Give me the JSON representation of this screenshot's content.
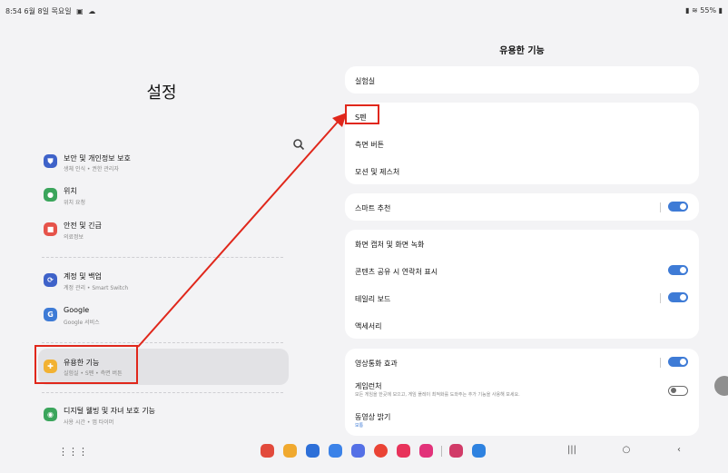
{
  "status_bar": {
    "time_date": "8:54 6월 8일 목요일",
    "battery": "55%"
  },
  "left_panel": {
    "title": "설정",
    "items": [
      {
        "title": "보안 및 개인정보 보호",
        "subtitle": "생체 인식 • 권한 관리자",
        "icon": "shield-icon",
        "color": "#3e62c9"
      },
      {
        "title": "위치",
        "subtitle": "위치 요청",
        "icon": "location-icon",
        "color": "#3ba55c"
      },
      {
        "title": "안전 및 긴급",
        "subtitle": "의료정보",
        "icon": "emergency-icon",
        "color": "#e6534a"
      },
      {
        "title": "계정 및 백업",
        "subtitle": "계정 관리 • Smart Switch",
        "icon": "sync-icon",
        "color": "#3e62c9"
      },
      {
        "title": "Google",
        "subtitle": "Google 서비스",
        "icon": "google-icon",
        "color": "#3e7bd6",
        "icon_text": "G"
      },
      {
        "title": "유용한 기능",
        "subtitle": "실험실 • S펜 • 측면 버튼",
        "icon": "gear-plus-icon",
        "color": "#f2b233"
      },
      {
        "title": "디지털 웰빙 및 자녀 보호 기능",
        "subtitle": "사용 시간 • 앱 타이머",
        "icon": "wellbeing-icon",
        "color": "#3ba55c"
      }
    ]
  },
  "right_panel": {
    "title": "유용한 기능",
    "labs": "실험실",
    "spen": "S펜",
    "side_button": "측면 버튼",
    "motions": "모션 및 제스처",
    "smart_suggestions": "스마트 추천",
    "screenshots": "화면 캡처 및 화면 녹화",
    "contact_sharing": "콘텐츠 공유 시 연락처 표시",
    "edge_panel": "테일리 보드",
    "accessories": "액세서리",
    "video_call_effects": "영상통화 효과",
    "game_launcher": "게임런처",
    "game_launcher_desc": "모든 게임을 한곳에 모으고, 게임 플레이 최적화를 도와주는 추가 기능을 사용해 보세요.",
    "video_brightness": "동영상 밝기",
    "video_brightness_value": "보통"
  },
  "toggles": {
    "smart_suggestions": true,
    "contact_sharing": true,
    "edge_panel": true,
    "video_call_effects": true,
    "game_launcher": false
  },
  "colors": {
    "accent": "#3e7bd6",
    "annotation": "#e0271b"
  }
}
